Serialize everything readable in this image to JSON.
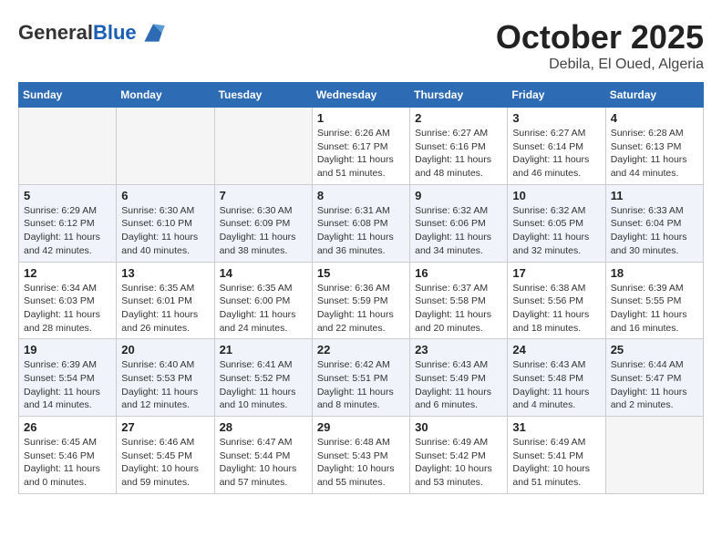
{
  "header": {
    "logo_line1": "General",
    "logo_line2": "Blue",
    "month": "October 2025",
    "location": "Debila, El Oued, Algeria"
  },
  "weekdays": [
    "Sunday",
    "Monday",
    "Tuesday",
    "Wednesday",
    "Thursday",
    "Friday",
    "Saturday"
  ],
  "weeks": [
    [
      {
        "day": "",
        "info": ""
      },
      {
        "day": "",
        "info": ""
      },
      {
        "day": "",
        "info": ""
      },
      {
        "day": "1",
        "info": "Sunrise: 6:26 AM\nSunset: 6:17 PM\nDaylight: 11 hours\nand 51 minutes."
      },
      {
        "day": "2",
        "info": "Sunrise: 6:27 AM\nSunset: 6:16 PM\nDaylight: 11 hours\nand 48 minutes."
      },
      {
        "day": "3",
        "info": "Sunrise: 6:27 AM\nSunset: 6:14 PM\nDaylight: 11 hours\nand 46 minutes."
      },
      {
        "day": "4",
        "info": "Sunrise: 6:28 AM\nSunset: 6:13 PM\nDaylight: 11 hours\nand 44 minutes."
      }
    ],
    [
      {
        "day": "5",
        "info": "Sunrise: 6:29 AM\nSunset: 6:12 PM\nDaylight: 11 hours\nand 42 minutes."
      },
      {
        "day": "6",
        "info": "Sunrise: 6:30 AM\nSunset: 6:10 PM\nDaylight: 11 hours\nand 40 minutes."
      },
      {
        "day": "7",
        "info": "Sunrise: 6:30 AM\nSunset: 6:09 PM\nDaylight: 11 hours\nand 38 minutes."
      },
      {
        "day": "8",
        "info": "Sunrise: 6:31 AM\nSunset: 6:08 PM\nDaylight: 11 hours\nand 36 minutes."
      },
      {
        "day": "9",
        "info": "Sunrise: 6:32 AM\nSunset: 6:06 PM\nDaylight: 11 hours\nand 34 minutes."
      },
      {
        "day": "10",
        "info": "Sunrise: 6:32 AM\nSunset: 6:05 PM\nDaylight: 11 hours\nand 32 minutes."
      },
      {
        "day": "11",
        "info": "Sunrise: 6:33 AM\nSunset: 6:04 PM\nDaylight: 11 hours\nand 30 minutes."
      }
    ],
    [
      {
        "day": "12",
        "info": "Sunrise: 6:34 AM\nSunset: 6:03 PM\nDaylight: 11 hours\nand 28 minutes."
      },
      {
        "day": "13",
        "info": "Sunrise: 6:35 AM\nSunset: 6:01 PM\nDaylight: 11 hours\nand 26 minutes."
      },
      {
        "day": "14",
        "info": "Sunrise: 6:35 AM\nSunset: 6:00 PM\nDaylight: 11 hours\nand 24 minutes."
      },
      {
        "day": "15",
        "info": "Sunrise: 6:36 AM\nSunset: 5:59 PM\nDaylight: 11 hours\nand 22 minutes."
      },
      {
        "day": "16",
        "info": "Sunrise: 6:37 AM\nSunset: 5:58 PM\nDaylight: 11 hours\nand 20 minutes."
      },
      {
        "day": "17",
        "info": "Sunrise: 6:38 AM\nSunset: 5:56 PM\nDaylight: 11 hours\nand 18 minutes."
      },
      {
        "day": "18",
        "info": "Sunrise: 6:39 AM\nSunset: 5:55 PM\nDaylight: 11 hours\nand 16 minutes."
      }
    ],
    [
      {
        "day": "19",
        "info": "Sunrise: 6:39 AM\nSunset: 5:54 PM\nDaylight: 11 hours\nand 14 minutes."
      },
      {
        "day": "20",
        "info": "Sunrise: 6:40 AM\nSunset: 5:53 PM\nDaylight: 11 hours\nand 12 minutes."
      },
      {
        "day": "21",
        "info": "Sunrise: 6:41 AM\nSunset: 5:52 PM\nDaylight: 11 hours\nand 10 minutes."
      },
      {
        "day": "22",
        "info": "Sunrise: 6:42 AM\nSunset: 5:51 PM\nDaylight: 11 hours\nand 8 minutes."
      },
      {
        "day": "23",
        "info": "Sunrise: 6:43 AM\nSunset: 5:49 PM\nDaylight: 11 hours\nand 6 minutes."
      },
      {
        "day": "24",
        "info": "Sunrise: 6:43 AM\nSunset: 5:48 PM\nDaylight: 11 hours\nand 4 minutes."
      },
      {
        "day": "25",
        "info": "Sunrise: 6:44 AM\nSunset: 5:47 PM\nDaylight: 11 hours\nand 2 minutes."
      }
    ],
    [
      {
        "day": "26",
        "info": "Sunrise: 6:45 AM\nSunset: 5:46 PM\nDaylight: 11 hours\nand 0 minutes."
      },
      {
        "day": "27",
        "info": "Sunrise: 6:46 AM\nSunset: 5:45 PM\nDaylight: 10 hours\nand 59 minutes."
      },
      {
        "day": "28",
        "info": "Sunrise: 6:47 AM\nSunset: 5:44 PM\nDaylight: 10 hours\nand 57 minutes."
      },
      {
        "day": "29",
        "info": "Sunrise: 6:48 AM\nSunset: 5:43 PM\nDaylight: 10 hours\nand 55 minutes."
      },
      {
        "day": "30",
        "info": "Sunrise: 6:49 AM\nSunset: 5:42 PM\nDaylight: 10 hours\nand 53 minutes."
      },
      {
        "day": "31",
        "info": "Sunrise: 6:49 AM\nSunset: 5:41 PM\nDaylight: 10 hours\nand 51 minutes."
      },
      {
        "day": "",
        "info": ""
      }
    ]
  ]
}
